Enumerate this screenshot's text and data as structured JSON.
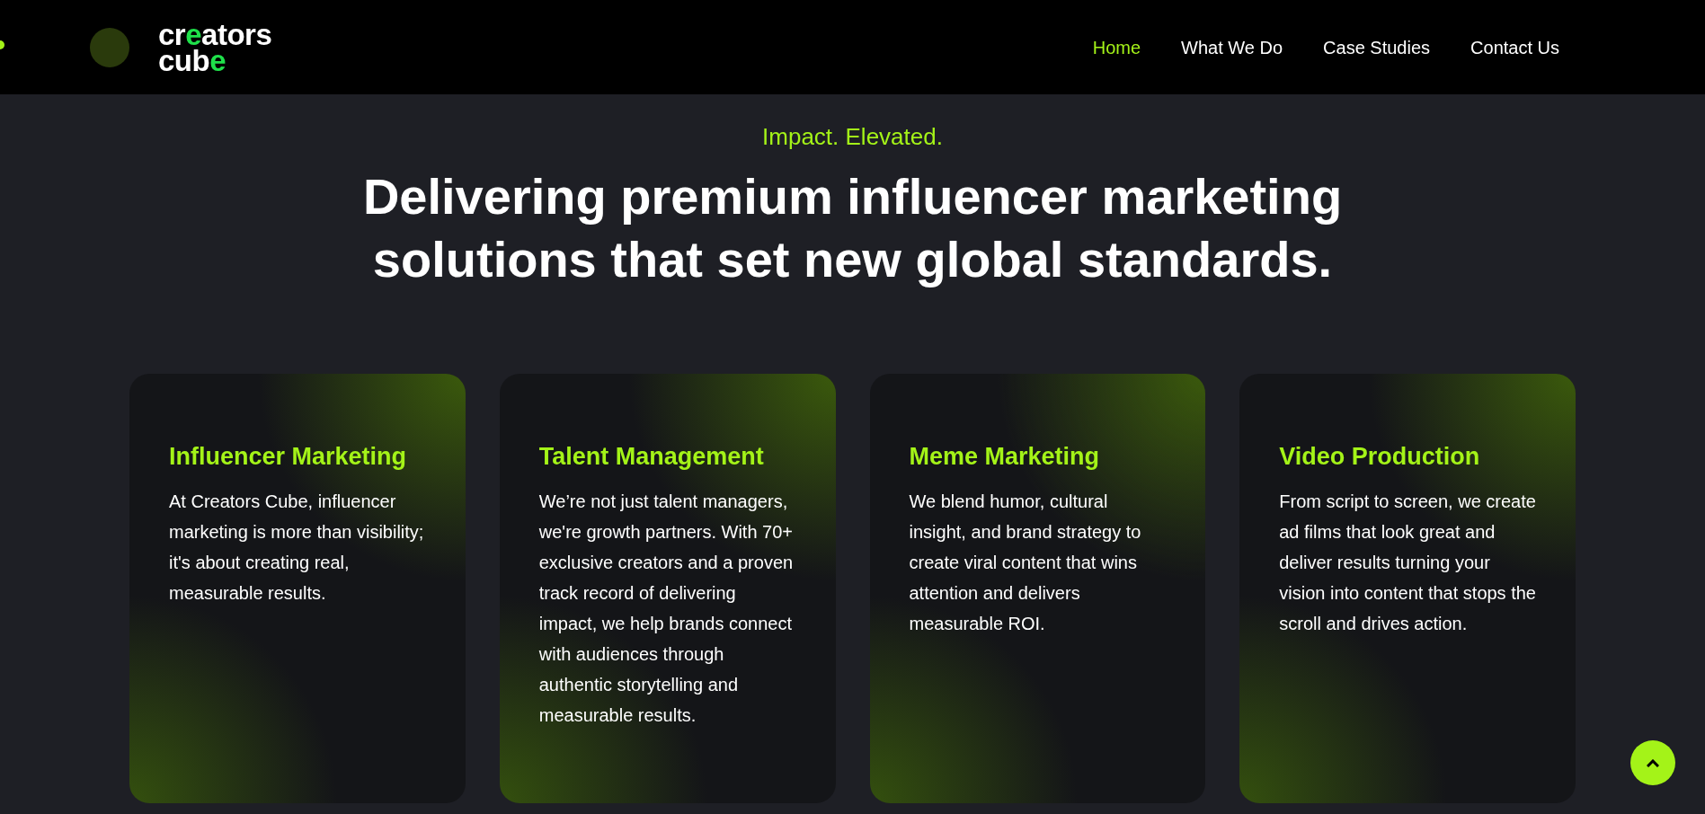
{
  "header": {
    "logo": [
      {
        "text": "cr",
        "accent": false
      },
      {
        "text": "e",
        "accent": true
      },
      {
        "text": "ators\ncub",
        "accent": false
      },
      {
        "text": "e",
        "accent": true
      }
    ],
    "nav": [
      {
        "label": "Home",
        "selected": true
      },
      {
        "label": "What We Do",
        "selected": false
      },
      {
        "label": "Case Studies",
        "selected": false
      },
      {
        "label": "Contact Us",
        "selected": false
      }
    ]
  },
  "hero": {
    "eyebrow": "Impact. Elevated.",
    "headline": "Delivering premium influencer marketing solutions that set new global standards."
  },
  "services": [
    {
      "title": "Influencer Marketing",
      "text": "At Creators Cube, influencer marketing is more than visibility; it's about creating real, measurable results."
    },
    {
      "title": "Talent Management",
      "text": "We’re not just talent managers, we're growth partners. With 70+ exclusive creators and a proven track record of delivering impact, we help brands connect with audiences through authentic storytelling and measurable results."
    },
    {
      "title": "Meme Marketing",
      "text": "We blend humor, cultural insight, and brand strategy to create viral content that wins attention and delivers measurable ROI."
    },
    {
      "title": "Video Production",
      "text": "From script to screen, we create ad films that look great and deliver results turning your vision into content that stops the scroll and drives action."
    }
  ]
}
